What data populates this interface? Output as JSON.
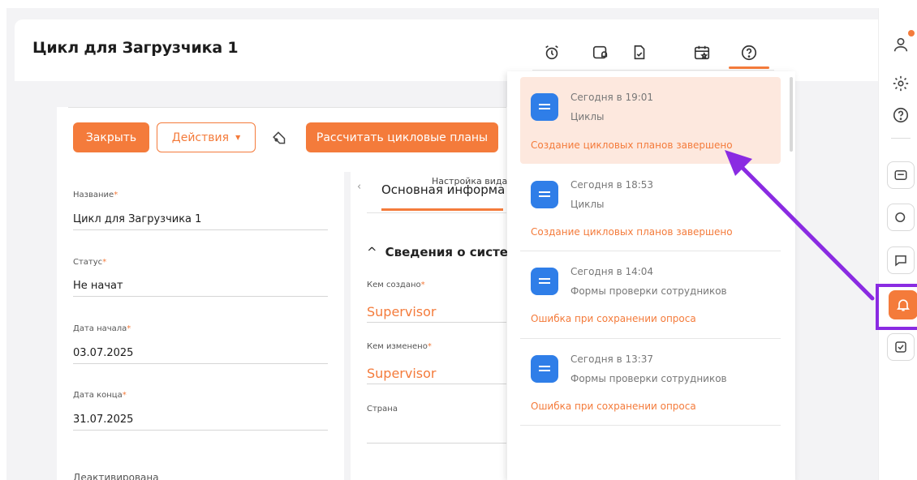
{
  "page": {
    "title": "Цикл для Загрузчика 1"
  },
  "toolbar": {
    "icons": [
      "alarm-clock-icon",
      "window-bell-icon",
      "document-check-icon",
      "calendar-star-icon",
      "help-icon"
    ],
    "active_icon": "help-icon"
  },
  "actions": {
    "close_label": "Закрыть",
    "actions_label": "Действия",
    "calc_label": "Рассчитать цикловые планы"
  },
  "form": {
    "fields": [
      {
        "label": "Название",
        "required": "*",
        "value": "Цикл для Загрузчика 1"
      },
      {
        "label": "Статус",
        "required": "*",
        "value": "Не начат"
      },
      {
        "label": "Дата начала",
        "required": "*",
        "value": "03.07.2025"
      },
      {
        "label": "Дата конца",
        "required": "*",
        "value": "31.07.2025"
      },
      {
        "label": "Деактивирована",
        "required": "",
        "value": ""
      }
    ]
  },
  "detail": {
    "settings_link": "Настройка вида",
    "tab_label": "Основная информа",
    "section_title": "Сведения о систе",
    "created_by_label": "Кем создано",
    "created_by_value": "Supervisor",
    "modified_by_label": "Кем изменено",
    "modified_by_value": "Supervisor",
    "country_label": "Страна",
    "required_mark": "*"
  },
  "notifications": [
    {
      "time": "Сегодня в 19:01",
      "category": "Циклы",
      "message": "Создание цикловых планов завершено",
      "highlighted": true
    },
    {
      "time": "Сегодня в 18:53",
      "category": "Циклы",
      "message": "Создание цикловых планов завершено",
      "highlighted": false
    },
    {
      "time": "Сегодня в 14:04",
      "category": "Формы проверки сотрудников",
      "message": "Ошибка при сохранении опроса",
      "highlighted": false
    },
    {
      "time": "Сегодня в 13:37",
      "category": "Формы проверки сотрудников",
      "message": "Ошибка при сохранении опроса",
      "highlighted": false
    }
  ],
  "rail": {
    "icons": [
      "user-icon",
      "settings-icon",
      "help-icon",
      "mail-icon",
      "chat-dots-icon",
      "message-icon",
      "bell-icon",
      "task-check-icon"
    ],
    "active": "bell-icon"
  },
  "colors": {
    "accent": "#f47b3b",
    "notif_icon": "#2f7ee8",
    "highlight_bg": "#fde8de",
    "annotation": "#8a2be2"
  }
}
